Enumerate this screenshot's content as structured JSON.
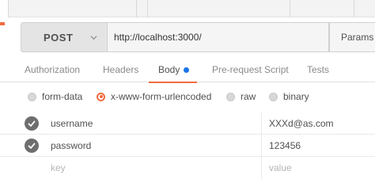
{
  "request": {
    "method": "POST",
    "url": "http://localhost:3000/",
    "params_label": "Params"
  },
  "tabs": [
    {
      "label": "Authorization",
      "active": false
    },
    {
      "label": "Headers",
      "active": false
    },
    {
      "label": "Body",
      "active": true
    },
    {
      "label": "Pre-request Script",
      "active": false
    },
    {
      "label": "Tests",
      "active": false
    }
  ],
  "body_modes": [
    {
      "label": "form-data",
      "selected": false
    },
    {
      "label": "x-www-form-urlencoded",
      "selected": true
    },
    {
      "label": "raw",
      "selected": false
    },
    {
      "label": "binary",
      "selected": false
    }
  ],
  "body_params": [
    {
      "key": "username",
      "value": "XXXd@as.com",
      "enabled": true
    },
    {
      "key": "password",
      "value": "123456",
      "enabled": true
    }
  ],
  "new_row": {
    "key_placeholder": "key",
    "value_placeholder": "value"
  },
  "colors": {
    "accent": "#f06d40",
    "body_dot": "#1a73e8",
    "check": "#6e6e6e"
  }
}
